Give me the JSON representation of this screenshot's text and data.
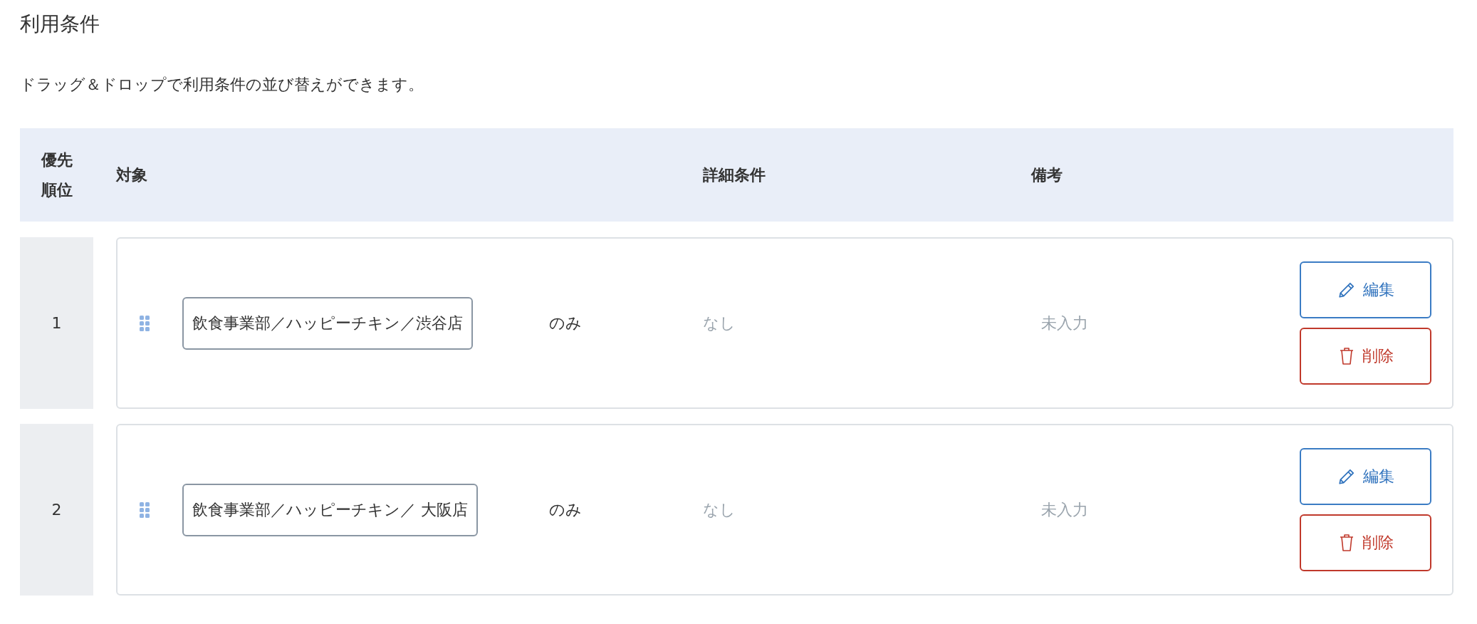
{
  "title": "利用条件",
  "description": "ドラッグ＆ドロップで利用条件の並び替えができます。",
  "table": {
    "columns": [
      "優先順位",
      "対象",
      "詳細条件",
      "備考"
    ],
    "rows": [
      {
        "priority": "1",
        "target": "飲食事業部／ハッピーチキン／渋谷店",
        "qualifier": "のみ",
        "detail": "なし",
        "note": "未入力",
        "actions": [
          {
            "kind": "edit",
            "label": "編集"
          },
          {
            "kind": "delete",
            "label": "削除"
          }
        ]
      },
      {
        "priority": "2",
        "target": "飲食事業部／ハッピーチキン／ 大阪店",
        "qualifier": "のみ",
        "detail": "なし",
        "note": "未入力",
        "actions": [
          {
            "kind": "edit",
            "label": "編集"
          },
          {
            "kind": "delete",
            "label": "削除"
          }
        ]
      }
    ]
  }
}
